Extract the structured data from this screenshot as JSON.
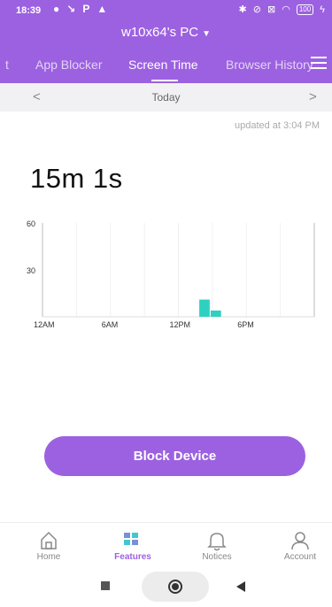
{
  "status": {
    "time": "18:39",
    "battery": "100"
  },
  "device": {
    "name": "w10x64's PC",
    "caret": "▼"
  },
  "tabs": [
    {
      "label": "t"
    },
    {
      "label": "App Blocker"
    },
    {
      "label": "Screen Time"
    },
    {
      "label": "Browser History"
    }
  ],
  "date_nav": {
    "prev": "<",
    "label": "Today",
    "next": ">"
  },
  "updated": "updated at 3:04 PM",
  "total": "15m 1s",
  "chart_data": {
    "type": "bar",
    "ylim": [
      0,
      60
    ],
    "yticks": [
      "60",
      "30"
    ],
    "xticks": [
      "12AM",
      "6AM",
      "12PM",
      "6PM"
    ],
    "bar_color": "#2ed1c0",
    "values_by_hour": [
      {
        "hour": 14,
        "minutes": 11
      },
      {
        "hour": 15,
        "minutes": 4
      }
    ]
  },
  "block_button": "Block Device",
  "bottom_nav": [
    {
      "label": "Home"
    },
    {
      "label": "Features"
    },
    {
      "label": "Notices"
    },
    {
      "label": "Account"
    }
  ],
  "colors": {
    "accent": "#9c61e0",
    "bar": "#2ed1c0"
  }
}
